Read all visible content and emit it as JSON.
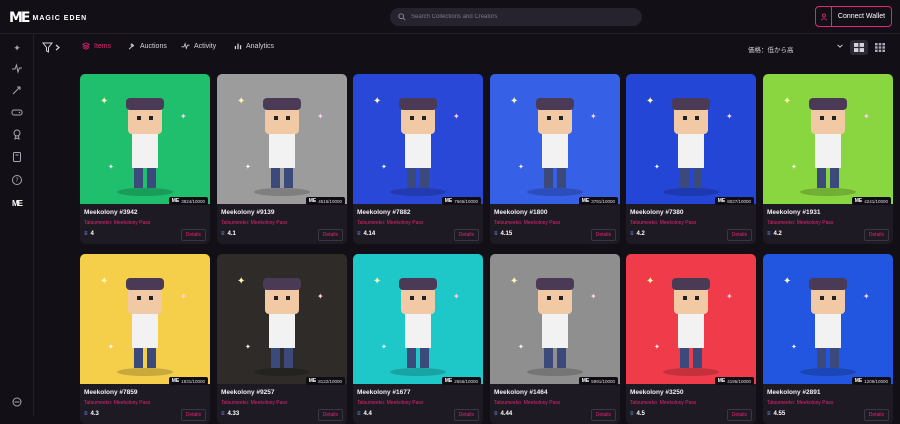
{
  "header": {
    "logo_mark": "ME",
    "logo_text": "MAGIC EDEN",
    "search_placeholder": "Search Collections and Creators",
    "connect_label": "Connect Wallet"
  },
  "sidebar": {
    "icons": [
      "sparkle-icon",
      "activity-icon",
      "rocket-icon",
      "gamepad-icon",
      "award-icon",
      "book-icon",
      "help-icon",
      "me-icon",
      "settings-icon"
    ]
  },
  "tabs": {
    "items": [
      {
        "label": "Items",
        "icon": "stack-icon",
        "active": true
      },
      {
        "label": "Auctions",
        "icon": "gavel-icon",
        "active": false
      },
      {
        "label": "Activity",
        "icon": "activity-icon",
        "active": false
      },
      {
        "label": "Analytics",
        "icon": "chart-icon",
        "active": false
      }
    ],
    "sort_label": "価格：低から高"
  },
  "card_labels": {
    "details": "Details",
    "collection": "Tatsumeeko: Meekolony Pass"
  },
  "colors": {
    "accent": "#e42575",
    "background": "#120f17",
    "card": "#1d1a23"
  },
  "cards": [
    {
      "title": "Meekolony #3942",
      "rank": "3824/10000",
      "price": "4",
      "bg": "#1fbf6e"
    },
    {
      "title": "Meekolony #9139",
      "rank": "4515/10000",
      "price": "4.1",
      "bg": "#9c9c9c"
    },
    {
      "title": "Meekolony #7882",
      "rank": "7665/10000",
      "price": "4.14",
      "bg": "#2a48d8"
    },
    {
      "title": "Meekolony #1800",
      "rank": "3791/10000",
      "price": "4.15",
      "bg": "#3660e6"
    },
    {
      "title": "Meekolony #7380",
      "rank": "8027/10000",
      "price": "4.2",
      "bg": "#2446d6"
    },
    {
      "title": "Meekolony #1931",
      "rank": "4241/10000",
      "price": "4.2",
      "bg": "#8ad640"
    },
    {
      "title": "Meekolony #7859",
      "rank": "1931/10000",
      "price": "4.3",
      "bg": "#f6cf4a"
    },
    {
      "title": "Meekolony #9257",
      "rank": "8122/10000",
      "price": "4.33",
      "bg": "#2e2b28"
    },
    {
      "title": "Meekolony #1677",
      "rank": "2656/10000",
      "price": "4.4",
      "bg": "#1fc8c8"
    },
    {
      "title": "Meekolony #1464",
      "rank": "5991/10000",
      "price": "4.44",
      "bg": "#8f8f8f"
    },
    {
      "title": "Meekolony #3250",
      "rank": "4195/10000",
      "price": "4.5",
      "bg": "#ef3b4a"
    },
    {
      "title": "Meekolony #2891",
      "rank": "1209/10000",
      "price": "4.55",
      "bg": "#2256e0"
    }
  ]
}
